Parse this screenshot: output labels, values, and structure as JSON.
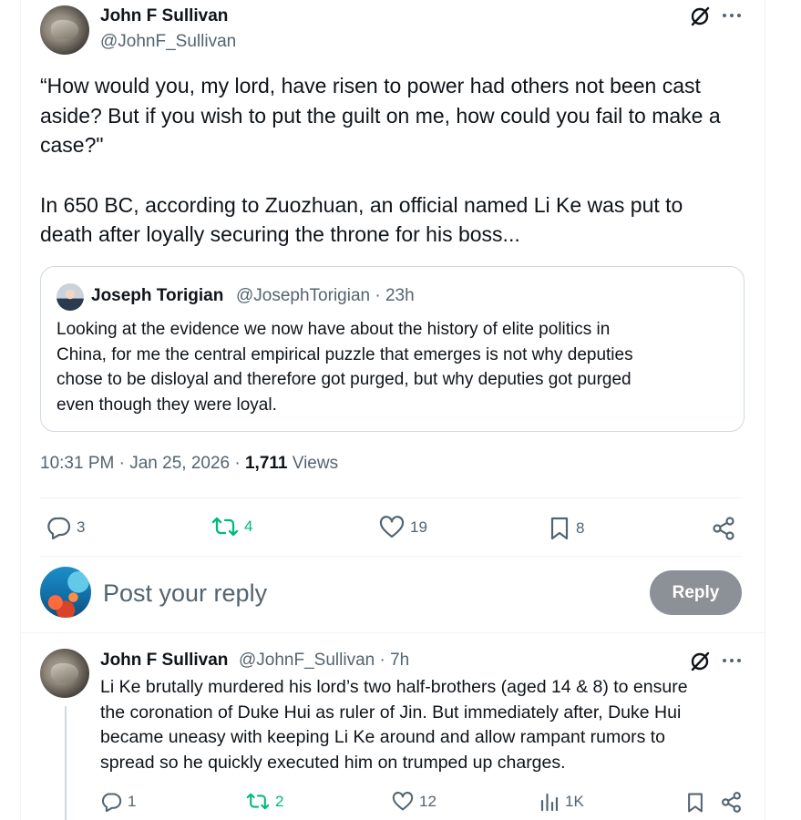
{
  "main_post": {
    "author_name": "John F Sullivan",
    "author_handle": "@JohnF_Sullivan",
    "text_line_1": "“How would you, my lord, have risen to power had others not been cast",
    "text_line_2": "aside? But if you wish to put the guilt on me, how could you fail to make a",
    "text_line_3": "case?\"",
    "text_line_4": "In 650 BC, according to Zuozhuan, an official named Li Ke was put to",
    "text_line_5": "death after loyally securing the throne for his boss...",
    "timestamp": "10:31 PM · Jan 25, 2026 · ",
    "views_count": "1,711",
    "views_label": " Views",
    "actions": {
      "replies": "3",
      "reposts": "4",
      "likes": "19",
      "bookmarks": "8"
    }
  },
  "quoted_post": {
    "author_name": "Joseph Torigian",
    "author_handle": "@JosephTorigian · 23h",
    "text_line_1": "Looking at the evidence we now have about the history of elite politics in",
    "text_line_2": "China, for me the central empirical puzzle that emerges is not why deputies",
    "text_line_3": "chose to be disloyal and therefore got purged, but why deputies got purged",
    "text_line_4": "even though they were loyal."
  },
  "composer": {
    "placeholder": "Post your reply",
    "reply_label": "Reply"
  },
  "reply_post": {
    "author_name": "John F Sullivan",
    "author_handle": "@JohnF_Sullivan · 7h",
    "text_line_1": "Li Ke brutally murdered his lord’s two half-brothers (aged 14 & 8) to ensure",
    "text_line_2": "the coronation of Duke Hui as ruler of Jin. But immediately after, Duke Hui",
    "text_line_3": "became uneasy with keeping Li Ke around and allow rampant rumors to",
    "text_line_4": "spread so he quickly executed him on trumped up charges.",
    "actions": {
      "replies": "1",
      "reposts": "2",
      "likes": "12",
      "views": "1K"
    }
  },
  "colors": {
    "text_primary": "#0f1419",
    "text_secondary": "#536471",
    "repost_green": "#00ba7c",
    "border": "#cfd9de",
    "reply_button_bg": "#8b9197"
  },
  "icons": [
    "grok-icon",
    "more-icon",
    "reply-icon",
    "repost-icon",
    "like-icon",
    "bookmark-icon",
    "share-icon",
    "views-icon"
  ]
}
